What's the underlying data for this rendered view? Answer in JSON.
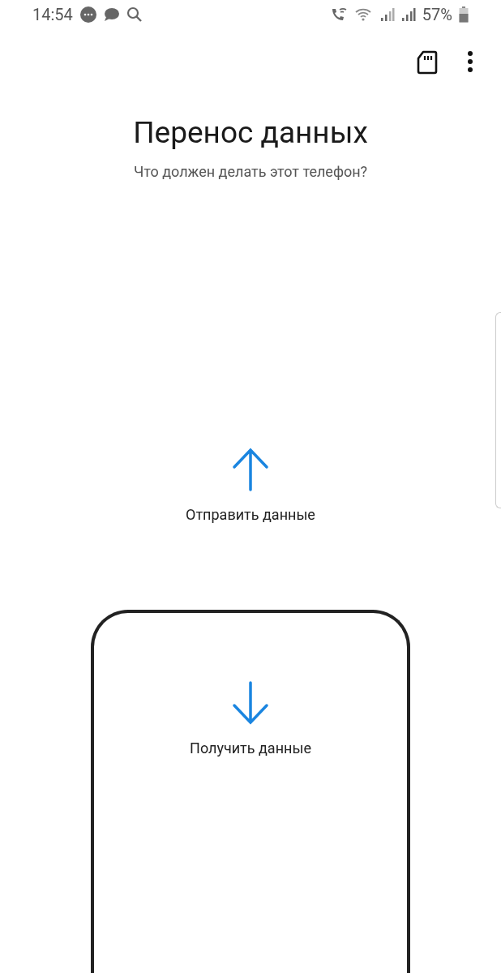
{
  "status_bar": {
    "time": "14:54",
    "battery": "57%"
  },
  "title": "Перенос данных",
  "subtitle": "Что должен делать этот телефон?",
  "options": [
    {
      "kind": "send",
      "label": "Отправить данные",
      "selected": false
    },
    {
      "kind": "receive",
      "label": "Получить данные",
      "selected": true
    }
  ]
}
